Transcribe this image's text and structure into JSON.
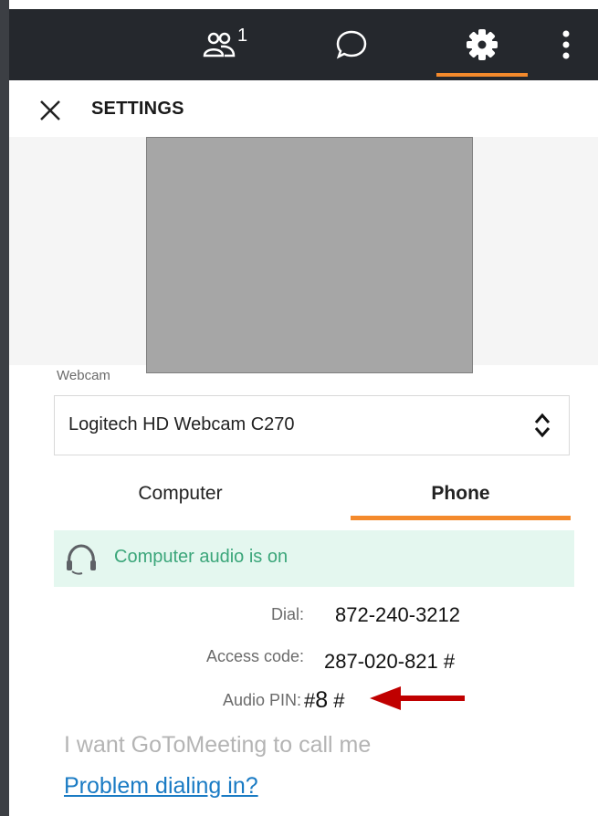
{
  "topbar": {
    "attendee_count": "1",
    "icons": [
      "attendees-icon",
      "chat-icon",
      "gear-icon",
      "more-vertical-icon"
    ],
    "active_tab": "settings",
    "accent": "#f48a2c",
    "background": "#25282d"
  },
  "header": {
    "title": "SETTINGS"
  },
  "webcam": {
    "label": "Webcam",
    "selected": "Logitech HD Webcam C270"
  },
  "audio_tabs": [
    {
      "label": "Computer",
      "active": false
    },
    {
      "label": "Phone",
      "active": true
    }
  ],
  "audio_status": {
    "text": "Computer audio is on",
    "color": "#3ba67a",
    "background": "#e4f7ef"
  },
  "phone_info": {
    "dial_label": "Dial:",
    "dial_value": "872-240-3212",
    "access_label": "Access code:",
    "access_value": "287-020-821 #",
    "pin_label": "Audio PIN:",
    "pin_value_prefix": "#",
    "pin_value_digit": "8",
    "pin_value_suffix": " #"
  },
  "annotation": {
    "arrow_color": "#c00000"
  },
  "links": {
    "call_me": "I want GoToMeeting to call me",
    "problem": "Problem dialing in?"
  }
}
